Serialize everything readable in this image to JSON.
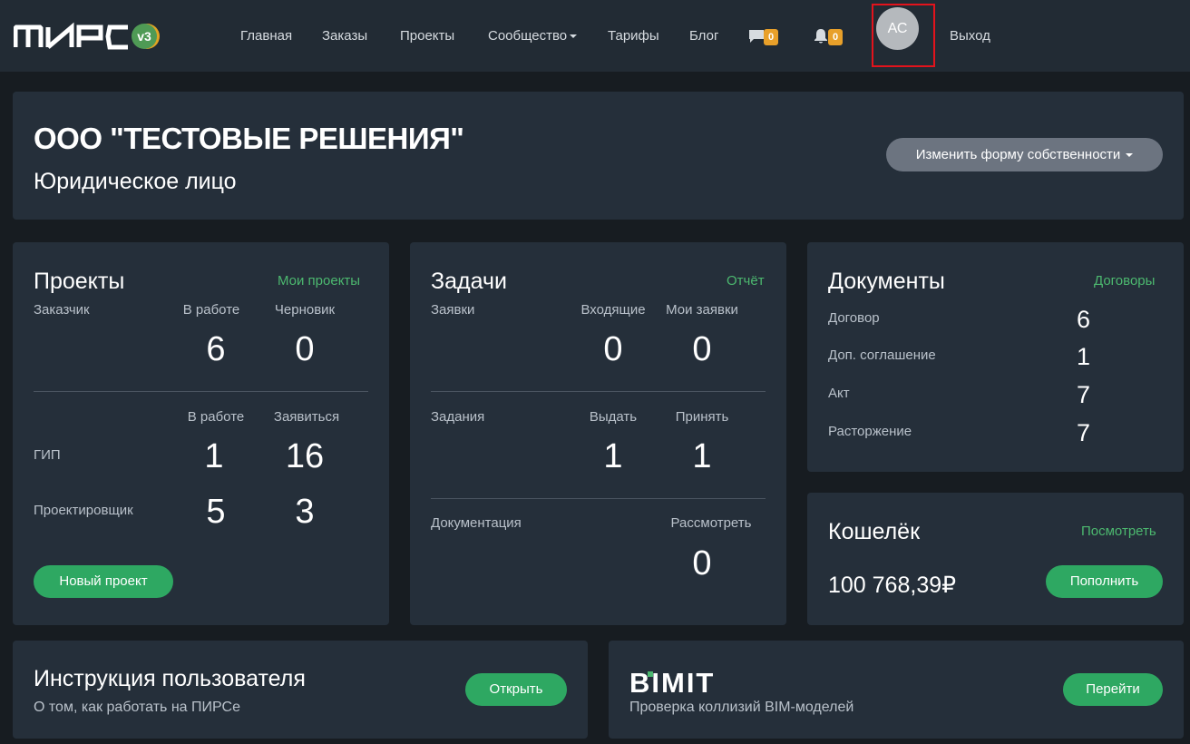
{
  "header": {
    "logo_text": "ПИРС",
    "logo_version": "v3",
    "nav": [
      "Главная",
      "Заказы",
      "Проекты",
      "Сообщество",
      "Тарифы",
      "Блог"
    ],
    "messages_count": "0",
    "notifications_count": "0",
    "avatar_initials": "АС",
    "logout_label": "Выход"
  },
  "company": {
    "name": "ООО \"ТЕСТОВЫЕ РЕШЕНИЯ\"",
    "type": "Юридическое лицо",
    "change_form_label": "Изменить форму собственности"
  },
  "projects": {
    "title": "Проекты",
    "link": "Мои проекты",
    "customer_label": "Заказчик",
    "col_in_work": "В работе",
    "col_draft": "Черновик",
    "customer_in_work": "6",
    "customer_draft": "0",
    "col2_in_work": "В работе",
    "col2_apply": "Заявиться",
    "gip_label": "ГИП",
    "gip_in_work": "1",
    "gip_apply": "16",
    "designer_label": "Проектировщик",
    "designer_in_work": "5",
    "designer_apply": "3",
    "new_project_label": "Новый проект"
  },
  "tasks": {
    "title": "Задачи",
    "link": "Отчёт",
    "requests_label": "Заявки",
    "incoming_label": "Входящие",
    "my_requests_label": "Мои заявки",
    "incoming": "0",
    "my_requests": "0",
    "assignments_label": "Задания",
    "issue_label": "Выдать",
    "accept_label": "Принять",
    "issue": "1",
    "accept": "1",
    "documentation_label": "Документация",
    "review_label": "Рассмотреть",
    "review": "0"
  },
  "documents": {
    "title": "Документы",
    "link": "Договоры",
    "rows": [
      {
        "label": "Договор",
        "value": "6"
      },
      {
        "label": "Доп. соглашение",
        "value": "1"
      },
      {
        "label": "Акт",
        "value": "7"
      },
      {
        "label": "Расторжение",
        "value": "7"
      }
    ]
  },
  "wallet": {
    "title": "Кошелёк",
    "link": "Посмотреть",
    "amount": "100 768,39₽",
    "topup_label": "Пополнить"
  },
  "instructions": {
    "title": "Инструкция пользователя",
    "subtitle": "О том, как работать на ПИРСе",
    "open_label": "Открыть"
  },
  "bimit": {
    "logo_text": "BIMIT",
    "subtitle": "Проверка коллизий BIM-моделей",
    "go_label": "Перейти"
  },
  "colors": {
    "background": "#171c21",
    "card": "#252f3a",
    "header": "#222b34",
    "accent_green": "#2ea862",
    "link_green": "#4cb86f",
    "badge_orange": "#e8a02a",
    "highlight_red": "#e3131c"
  }
}
